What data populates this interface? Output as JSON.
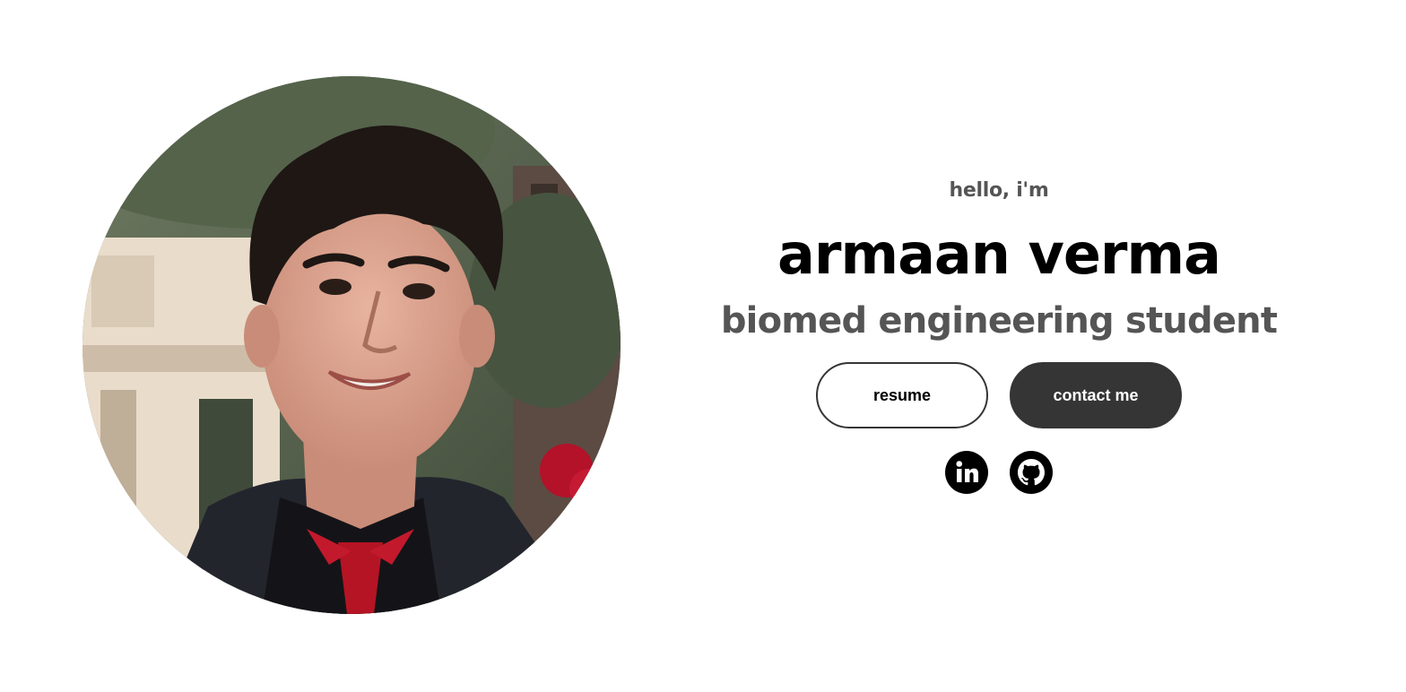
{
  "profile": {
    "photo_icon": "profile-photo",
    "greeting": "hello, i'm",
    "name": "armaan verma",
    "title": "biomed engineering student"
  },
  "buttons": {
    "resume_label": "resume",
    "contact_label": "contact me"
  },
  "socials": [
    {
      "icon": "linkedin-icon"
    },
    {
      "icon": "github-icon"
    }
  ],
  "colors": {
    "background": "#ffffff",
    "text_primary": "#000000",
    "text_secondary": "#555555",
    "button_dark": "#353535"
  }
}
